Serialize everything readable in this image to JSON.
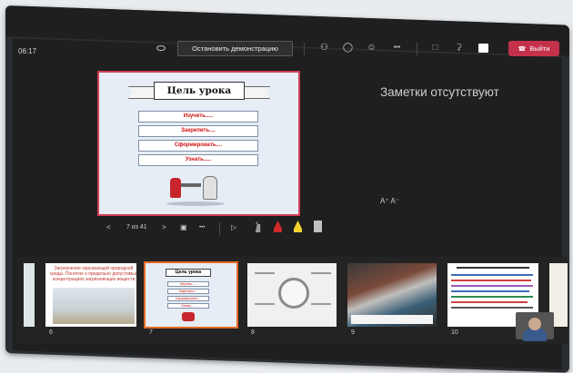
{
  "topbar": {
    "time": "06:17",
    "stop_presenting_label": "Остановить демонстрацию",
    "more_label": "•••",
    "leave_label": "Выйти"
  },
  "slide": {
    "title": "Цель урока",
    "items": [
      "Изучить.....",
      "Закрепить....",
      "Сформировать....",
      "Узнать....."
    ]
  },
  "notes": {
    "empty_text": "Заметки отсутствуют",
    "font_size_label": "A⁺ A⁻"
  },
  "navigation": {
    "prev": "<",
    "page_indicator": "7 из 41",
    "next": ">",
    "more": "•••"
  },
  "thumbnails": [
    {
      "number": "6",
      "title": "Загрязнение окружающей природной среды. Понятие о предельно допустимых концентрациях загрязняющих веществ"
    },
    {
      "number": "7",
      "title": "Цель урока"
    },
    {
      "number": "8",
      "title": ""
    },
    {
      "number": "9",
      "title": ""
    },
    {
      "number": "10",
      "title": ""
    }
  ],
  "colors": {
    "leave": "#c4314b",
    "selected_thumb": "#e46b24",
    "slide_border": "#d13e55"
  }
}
